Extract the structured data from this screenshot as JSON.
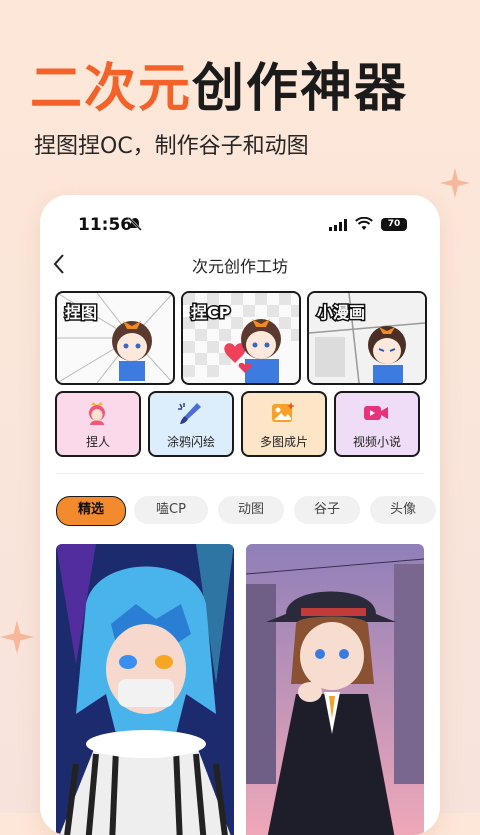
{
  "hero": {
    "accent": "二次元",
    "main": "创作神器",
    "subtitle": "捏图捏OC，制作谷子和动图"
  },
  "status": {
    "time": "11:56",
    "battery": "70"
  },
  "nav": {
    "title": "次元创作工坊",
    "back_icon": "chevron-left-icon"
  },
  "cards": [
    {
      "label": "捏图"
    },
    {
      "label": "捏CP"
    },
    {
      "label": "小漫画"
    }
  ],
  "tools": [
    {
      "label": "捏人",
      "icon": "princess-icon",
      "bg": "#fbd9ea"
    },
    {
      "label": "涂鸦闪绘",
      "icon": "brush-icon",
      "bg": "#dceefc"
    },
    {
      "label": "多图成片",
      "icon": "photo-collage-icon",
      "bg": "#fde6c8"
    },
    {
      "label": "视频小说",
      "icon": "video-camera-icon",
      "bg": "#efdcf7"
    }
  ],
  "tabs": [
    {
      "label": "精选"
    },
    {
      "label": "嗑CP"
    },
    {
      "label": "动图"
    },
    {
      "label": "谷子"
    },
    {
      "label": "头像"
    }
  ],
  "colors": {
    "accent": "#f4622a",
    "active_tab": "#f38a2e"
  }
}
